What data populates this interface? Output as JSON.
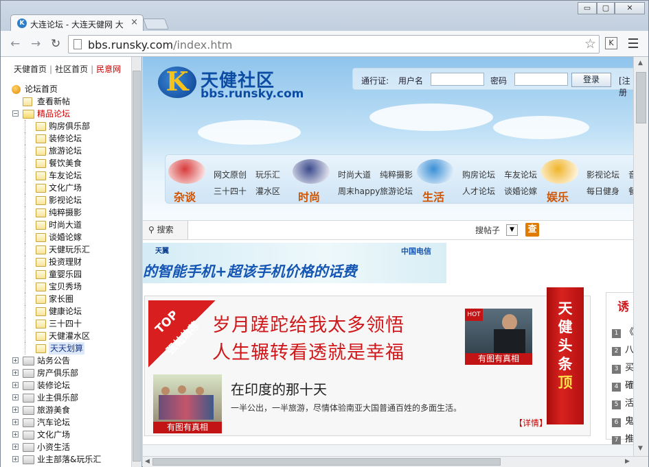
{
  "browser": {
    "tab_title": "大连论坛 - 大连天健网 大",
    "tab_close": "×",
    "url_host": "bbs.runsky.com",
    "url_path": "/index.htm",
    "ext_icon": "K",
    "win_min": "▭",
    "win_max": "▢",
    "win_close": "✕"
  },
  "sidebar": {
    "top_links": [
      "天健首页",
      "社区首页",
      "民意网"
    ],
    "root": "论坛首页",
    "items": [
      {
        "label": "查看新帖",
        "level": 1,
        "type": "page"
      },
      {
        "label": "精品论坛",
        "level": 1,
        "type": "open",
        "style": "red"
      },
      {
        "label": "购房俱乐部",
        "level": 2
      },
      {
        "label": "装修论坛",
        "level": 2
      },
      {
        "label": "旅游论坛",
        "level": 2
      },
      {
        "label": "餐饮美食",
        "level": 2
      },
      {
        "label": "车友论坛",
        "level": 2
      },
      {
        "label": "文化广场",
        "level": 2
      },
      {
        "label": "影视论坛",
        "level": 2
      },
      {
        "label": "纯粹摄影",
        "level": 2
      },
      {
        "label": "时尚大道",
        "level": 2
      },
      {
        "label": "谈婚论嫁",
        "level": 2
      },
      {
        "label": "天健玩乐汇",
        "level": 2
      },
      {
        "label": "投资理财",
        "level": 2
      },
      {
        "label": "童婴乐园",
        "level": 2
      },
      {
        "label": "宝贝秀场",
        "level": 2
      },
      {
        "label": "家长圈",
        "level": 2
      },
      {
        "label": "健康论坛",
        "level": 2
      },
      {
        "label": "三十四十",
        "level": 2
      },
      {
        "label": "天健灌水区",
        "level": 2
      },
      {
        "label": "天天划算",
        "level": 2,
        "style": "sel"
      },
      {
        "label": "站务公告",
        "level": 1,
        "type": "closed"
      },
      {
        "label": "房产俱乐部",
        "level": 1,
        "type": "closed"
      },
      {
        "label": "装修论坛",
        "level": 1,
        "type": "closed"
      },
      {
        "label": "业主俱乐部",
        "level": 1,
        "type": "closed"
      },
      {
        "label": "旅游美食",
        "level": 1,
        "type": "closed"
      },
      {
        "label": "汽车论坛",
        "level": 1,
        "type": "closed"
      },
      {
        "label": "文化广场",
        "level": 1,
        "type": "closed"
      },
      {
        "label": "小资生活",
        "level": 1,
        "type": "closed"
      },
      {
        "label": "业主部落&玩乐汇",
        "level": 1,
        "type": "closed"
      }
    ]
  },
  "header": {
    "logo_mark": "K",
    "logo_title": "天健社区",
    "logo_domain": "bbs.runsky.com",
    "login_label": "通行证:",
    "username_label": "用户名",
    "password_label": "密码",
    "login_button": "登录",
    "register_link": "[注册"
  },
  "categories": [
    {
      "name": "杂谈",
      "links": [
        "网文原创",
        "玩乐汇",
        "三十四十",
        "灌水区"
      ],
      "color": "#d83b3b"
    },
    {
      "name": "时尚",
      "links": [
        "时尚大道",
        "纯粹摄影",
        "周末happy",
        "旅游论坛"
      ],
      "color": "#3b4a8c"
    },
    {
      "name": "生活",
      "links": [
        "购房论坛",
        "车友论坛",
        "人才论坛",
        "谈婚论嫁"
      ],
      "color": "#3a8fd6"
    },
    {
      "name": "娱乐",
      "links": [
        "影视论坛",
        "音",
        "每日健身",
        "餐"
      ],
      "color": "#f0b52a"
    }
  ],
  "search": {
    "label": "搜索",
    "scope": "搜帖子",
    "go": "查"
  },
  "ad": {
    "text": "的智能手机+超该手机价格的话费",
    "brand": "天翼",
    "telecom": "中国电信"
  },
  "feature": {
    "corner_top": "TOP",
    "corner_sub": "强帖热荐",
    "headline1": "岁月蹉跎给我太多领悟",
    "headline2": "人生辗转看透就是幸福",
    "photo_caption": "有图有真相",
    "hot": "HOT",
    "story_title": "在印度的那十天",
    "story_desc": "一半公出，一半旅游，尽情体验南亚大国普通百姓的多面生活。",
    "more": "【详情】",
    "ribbon_upper": [
      "天",
      "健",
      "头",
      "条"
    ],
    "ribbon_lower": "顶"
  },
  "rightcol": {
    "title": "诱",
    "items": [
      "《",
      "八",
      "买",
      "確",
      "活",
      "鬼",
      "推"
    ]
  }
}
